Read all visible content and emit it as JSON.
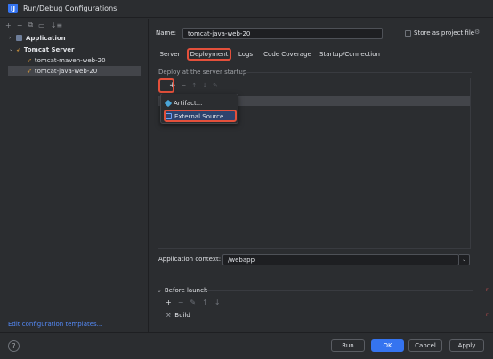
{
  "window": {
    "title": "Run/Debug Configurations",
    "app_icon": "IJ"
  },
  "left_toolbar": {
    "add": "+",
    "remove": "−",
    "copy": "⧉",
    "folder": "▭",
    "sort": "↓≡"
  },
  "tree": [
    {
      "label": "Application",
      "arrow": "›",
      "icon_color": "#6e7e9a"
    },
    {
      "label": "Tomcat Server",
      "arrow": "⌄",
      "icon_color": "#e6a23c"
    },
    {
      "label": "tomcat-maven-web-20"
    },
    {
      "label": "tomcat-java-web-20"
    }
  ],
  "edit_templates": "Edit configuration templates...",
  "form": {
    "name_label": "Name:",
    "name_value": "tomcat-java-web-20",
    "store_label": "Store as project file"
  },
  "tabs": [
    "Server",
    "Deployment",
    "Logs",
    "Code Coverage",
    "Startup/Connection"
  ],
  "deploy": {
    "section_label": "Deploy at the server startup",
    "toolbar": {
      "add": "+",
      "remove": "−",
      "up": "↑",
      "down": "↓",
      "edit": "✎"
    }
  },
  "popup": {
    "items": [
      {
        "label": "Artifact...",
        "icon_color": "#4aa5d8"
      },
      {
        "label": "External Source...",
        "icon_color": "#6fa1f5"
      }
    ]
  },
  "app_context": {
    "label": "Application context:",
    "value": "/webapp",
    "dropdown": "⌄"
  },
  "before_launch": {
    "label": "Before launch",
    "toolbar": [
      "+",
      "−",
      "✎",
      "↑",
      "↓"
    ],
    "item": "Build"
  },
  "buttons": {
    "help": "?",
    "run": "Run",
    "ok": "OK",
    "cancel": "Cancel",
    "apply": "Apply"
  },
  "colors": {
    "accent": "#3574f0",
    "highlight": "#e4503b"
  }
}
